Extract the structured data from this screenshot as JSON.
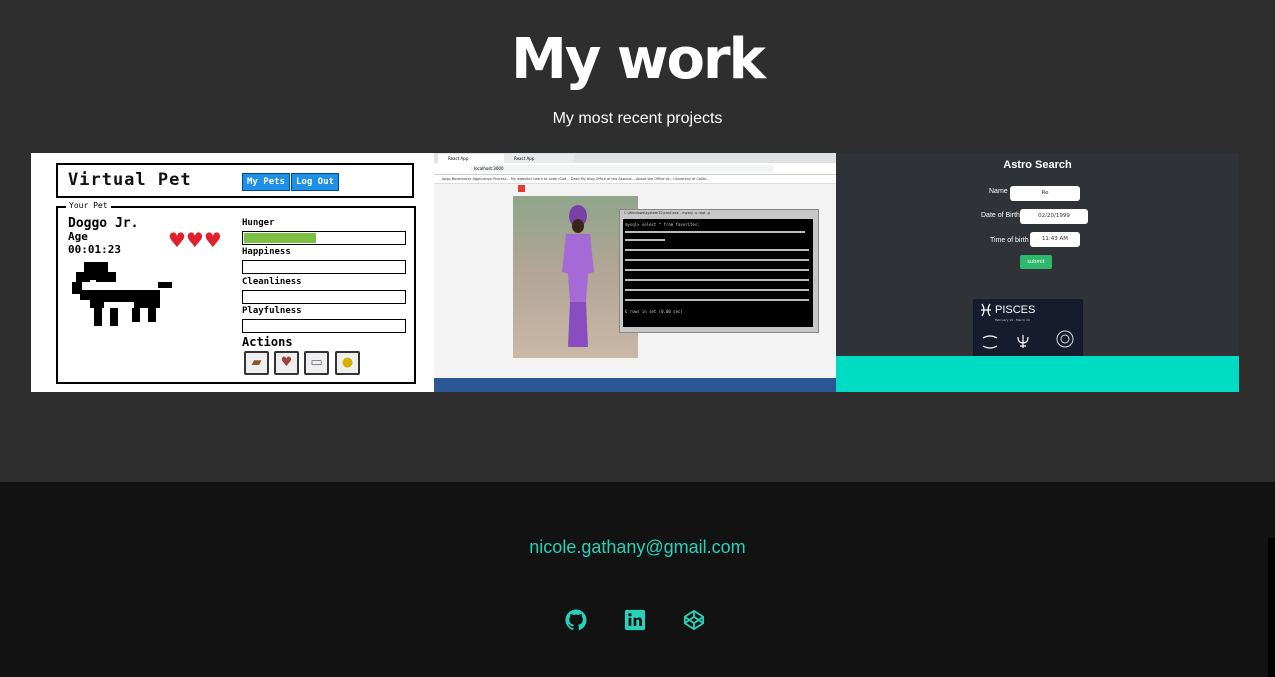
{
  "header": {
    "title": "My work",
    "subtitle": "My most recent projects"
  },
  "projects": [
    {
      "app_title": "Virtual Pet",
      "buttons": [
        "My Pets",
        "Log Out"
      ],
      "panel_legend": "Your Pet",
      "pet_name": "Doggo Jr.",
      "age_label": "Age",
      "age_time": "00:01:23",
      "hearts": "♥♥♥",
      "stats": [
        {
          "label": "Hunger",
          "level": 0.45
        },
        {
          "label": "Happiness",
          "level": 0
        },
        {
          "label": "Cleanliness",
          "level": 0
        },
        {
          "label": "Playfulness",
          "level": 0
        }
      ],
      "actions_label": "Actions",
      "action_icons": [
        "bread-icon",
        "heart-icon",
        "bathtub-icon",
        "coin-icon"
      ]
    },
    {
      "tabs": [
        "React App",
        "React App"
      ],
      "url": "localhost:3000",
      "bookmarks": "Apps  Bookmarks  Application Process...  My website!  Learn to code (Cod...  Dash  My blog  Office of the Associa...  About the Office of...  University of Califo...",
      "terminal_title": "C:\\Windows\\system32\\cmd.exe - mysql -u root -p",
      "terminal_query": "mysql> select * from favorites;",
      "terminal_footer": "6 rows in set (0.00 sec)"
    },
    {
      "title": "Astro Search",
      "fields": [
        {
          "label": "Name",
          "value": "Re"
        },
        {
          "label": "Date of Birth",
          "value": "02/20/1999"
        },
        {
          "label": "Time of birth",
          "value": "11:43 AM"
        }
      ],
      "submit_label": "submit",
      "sign_title": "PISCES",
      "sign_dates": "February 19 - March 20"
    }
  ],
  "footer": {
    "email": "nicole.gathany@gmail.com",
    "social_icons": [
      "github-icon",
      "linkedin-icon",
      "codepen-icon"
    ]
  },
  "colors": {
    "accent": "#2ad1b9",
    "header_bg": "#2e2e2e",
    "footer_bg": "#121212"
  }
}
